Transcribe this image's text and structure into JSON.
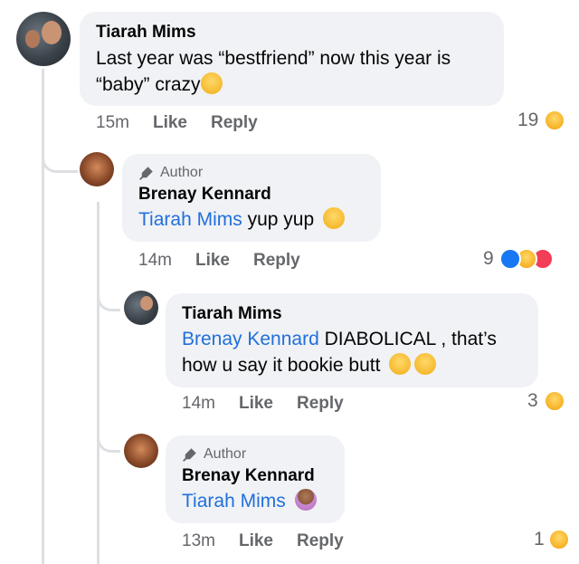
{
  "comments": [
    {
      "name": "Tiarah Mims",
      "text_line1": "Last year was “bestfriend” now this year is",
      "text_line2": "“baby” crazy",
      "time": "15m",
      "like_label": "Like",
      "reply_label": "Reply",
      "reaction_count": "19",
      "reaction_icons": [
        "haha-icon"
      ]
    },
    {
      "author_badge": "Author",
      "name": "Brenay Kennard",
      "mention": "Tiarah Mims",
      "text": " yup yup ",
      "time": "14m",
      "like_label": "Like",
      "reply_label": "Reply",
      "reaction_count": "9",
      "reaction_icons": [
        "like-icon",
        "haha-icon",
        "love-icon"
      ]
    },
    {
      "name": "Tiarah Mims",
      "mention": "Brenay Kennard",
      "text_line1": " DIABOLICAL  , that’s",
      "text_line2": "how u say it bookie butt ",
      "time": "14m",
      "like_label": "Like",
      "reply_label": "Reply",
      "reaction_count": "3",
      "reaction_icons": [
        "haha-icon"
      ]
    },
    {
      "author_badge": "Author",
      "name": "Brenay Kennard",
      "mention": "Tiarah Mims",
      "time": "13m",
      "like_label": "Like",
      "reply_label": "Reply",
      "reaction_count": "1",
      "reaction_icons": [
        "sad-icon"
      ]
    }
  ]
}
